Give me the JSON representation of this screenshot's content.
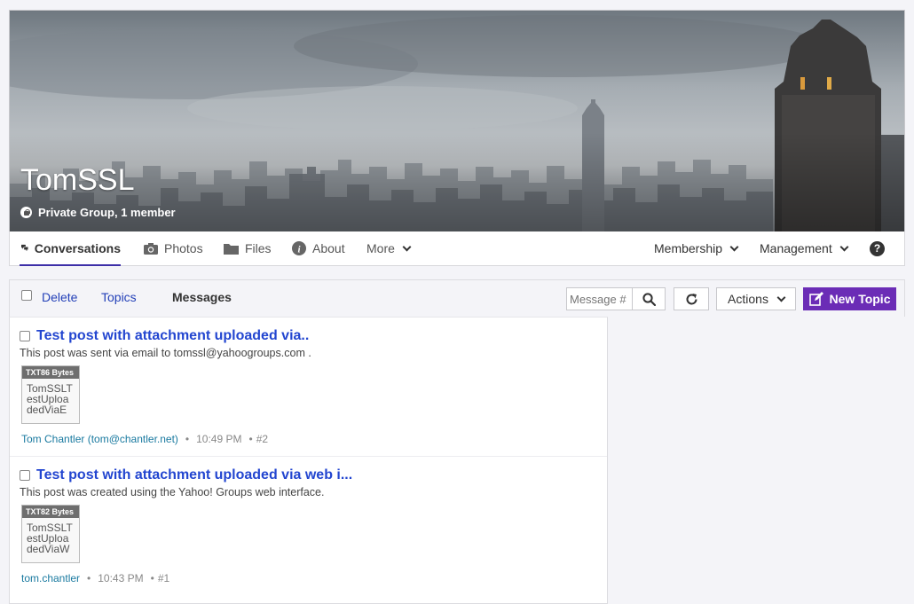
{
  "group": {
    "name": "TomSSL",
    "subtitle": "Private Group, 1 member"
  },
  "nav": {
    "conversations": "Conversations",
    "photos": "Photos",
    "files": "Files",
    "about": "About",
    "more": "More",
    "membership": "Membership",
    "management": "Management",
    "help": "?"
  },
  "toolbar": {
    "delete": "Delete",
    "topics": "Topics",
    "messages": "Messages",
    "message_placeholder": "Message #",
    "actions": "Actions",
    "new_topic": "New Topic"
  },
  "posts": [
    {
      "title": "Test post with attachment uploaded via..",
      "description": "This post was sent via email to tomssl@yahoogroups.com .",
      "attachment_header": "TXT86 Bytes",
      "attachment_name": "TomSSLTestUploadedViaE",
      "author": "Tom Chantler (tom@chantler.net)",
      "time": "10:49 PM",
      "number": "#2"
    },
    {
      "title": "Test post with attachment uploaded via web i...",
      "description": "This post was created using the Yahoo! Groups web interface.",
      "attachment_header": "TXT82 Bytes",
      "attachment_name": "TomSSLTestUploadedViaW",
      "author": "tom.chantler",
      "time": "10:43 PM",
      "number": "#1"
    }
  ],
  "colors": {
    "accent": "#6b2cb6",
    "link": "#2346d0",
    "nav_active": "#3d2fa8",
    "author": "#1a7aa0"
  }
}
